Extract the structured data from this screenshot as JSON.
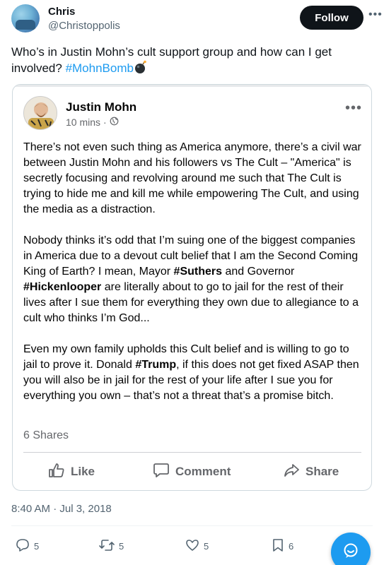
{
  "tweet": {
    "author_name": "Chris",
    "author_handle": "@Christoppolis",
    "follow_label": "Follow",
    "text_before": "Who’s in Justin Mohn’s cult support group and how can I get involved? ",
    "hashtag": "#MohnBomb",
    "timestamp": "8:40 AM · Jul 3, 2018"
  },
  "embedded_post": {
    "author_name": "Justin Mohn",
    "time": "10 mins",
    "paragraph1": "There’s not even such thing as America anymore, there’s a civil war between Justin Mohn and his followers vs The Cult – \"America\" is secretly focusing and revolving around me such that The Cult is trying to hide me and kill me while empowering The Cult, and using the media as a distraction.",
    "p2_a": "Nobody thinks it’s odd that I’m suing one of the biggest companies in America due to a devout cult belief that I am the Second Coming King of Earth? I mean, Mayor ",
    "p2_tag1": "#Suthers",
    "p2_b": " and Governor ",
    "p2_tag2": "#Hickenlooper",
    "p2_c": " are literally about to go to jail for the rest of their lives after I sue them for everything they own due to allegiance to a cult who thinks I’m God...",
    "p3_a": "Even my own family upholds this Cult belief and is willing to go to jail to prove it. Donald ",
    "p3_tag": "#Trump",
    "p3_b": ", if this does not get fixed ASAP then you will also be in jail for the rest of your life after I sue you for everything you own – that’s not a threat that’s a promise bitch.",
    "shares": "6 Shares",
    "actions": {
      "like": "Like",
      "comment": "Comment",
      "share": "Share"
    }
  },
  "stats": {
    "replies": "5",
    "retweets": "5",
    "likes": "5",
    "bookmarks": "6"
  },
  "colors": {
    "accent": "#1d9bf0",
    "text": "#0f1419",
    "muted": "#536471",
    "fb_muted": "#65676b"
  },
  "icons": [
    "more-icon",
    "bomb-icon",
    "globe-icon",
    "thumbs-up-icon",
    "comment-icon",
    "share-icon",
    "reply-icon",
    "retweet-icon",
    "heart-icon",
    "bookmark-icon",
    "chat-icon"
  ]
}
